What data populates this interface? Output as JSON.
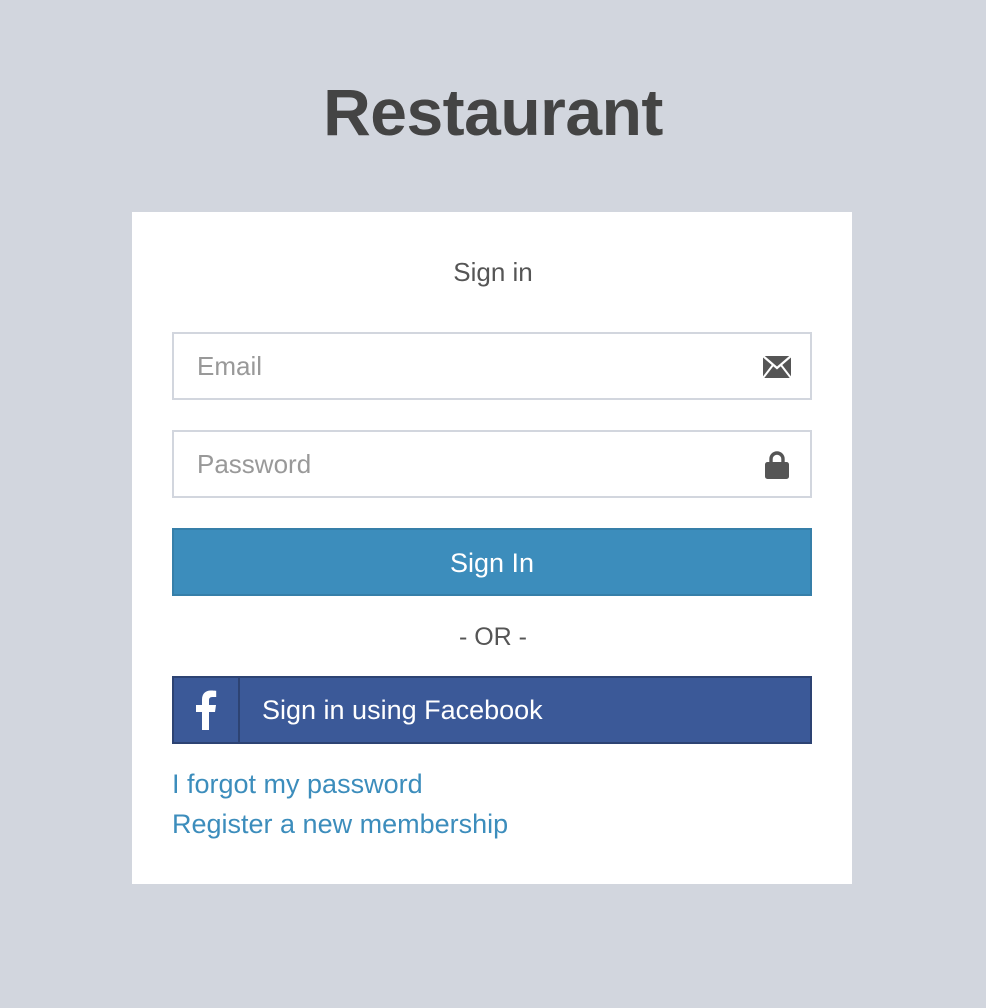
{
  "app": {
    "title": "Restaurant"
  },
  "login": {
    "heading": "Sign in",
    "email": {
      "placeholder": "Email",
      "value": "",
      "icon": "envelope-icon"
    },
    "password": {
      "placeholder": "Password",
      "value": "",
      "icon": "lock-icon"
    },
    "submit_label": "Sign In",
    "divider_text": "- OR -",
    "facebook": {
      "label": "Sign in using Facebook",
      "icon": "facebook-icon"
    },
    "links": {
      "forgot_password": "I forgot my password",
      "register": "Register a new membership"
    }
  },
  "colors": {
    "background": "#d2d6de",
    "primary": "#3c8dbc",
    "facebook": "#3b5998",
    "link": "#3c8dbc",
    "title": "#444444"
  }
}
